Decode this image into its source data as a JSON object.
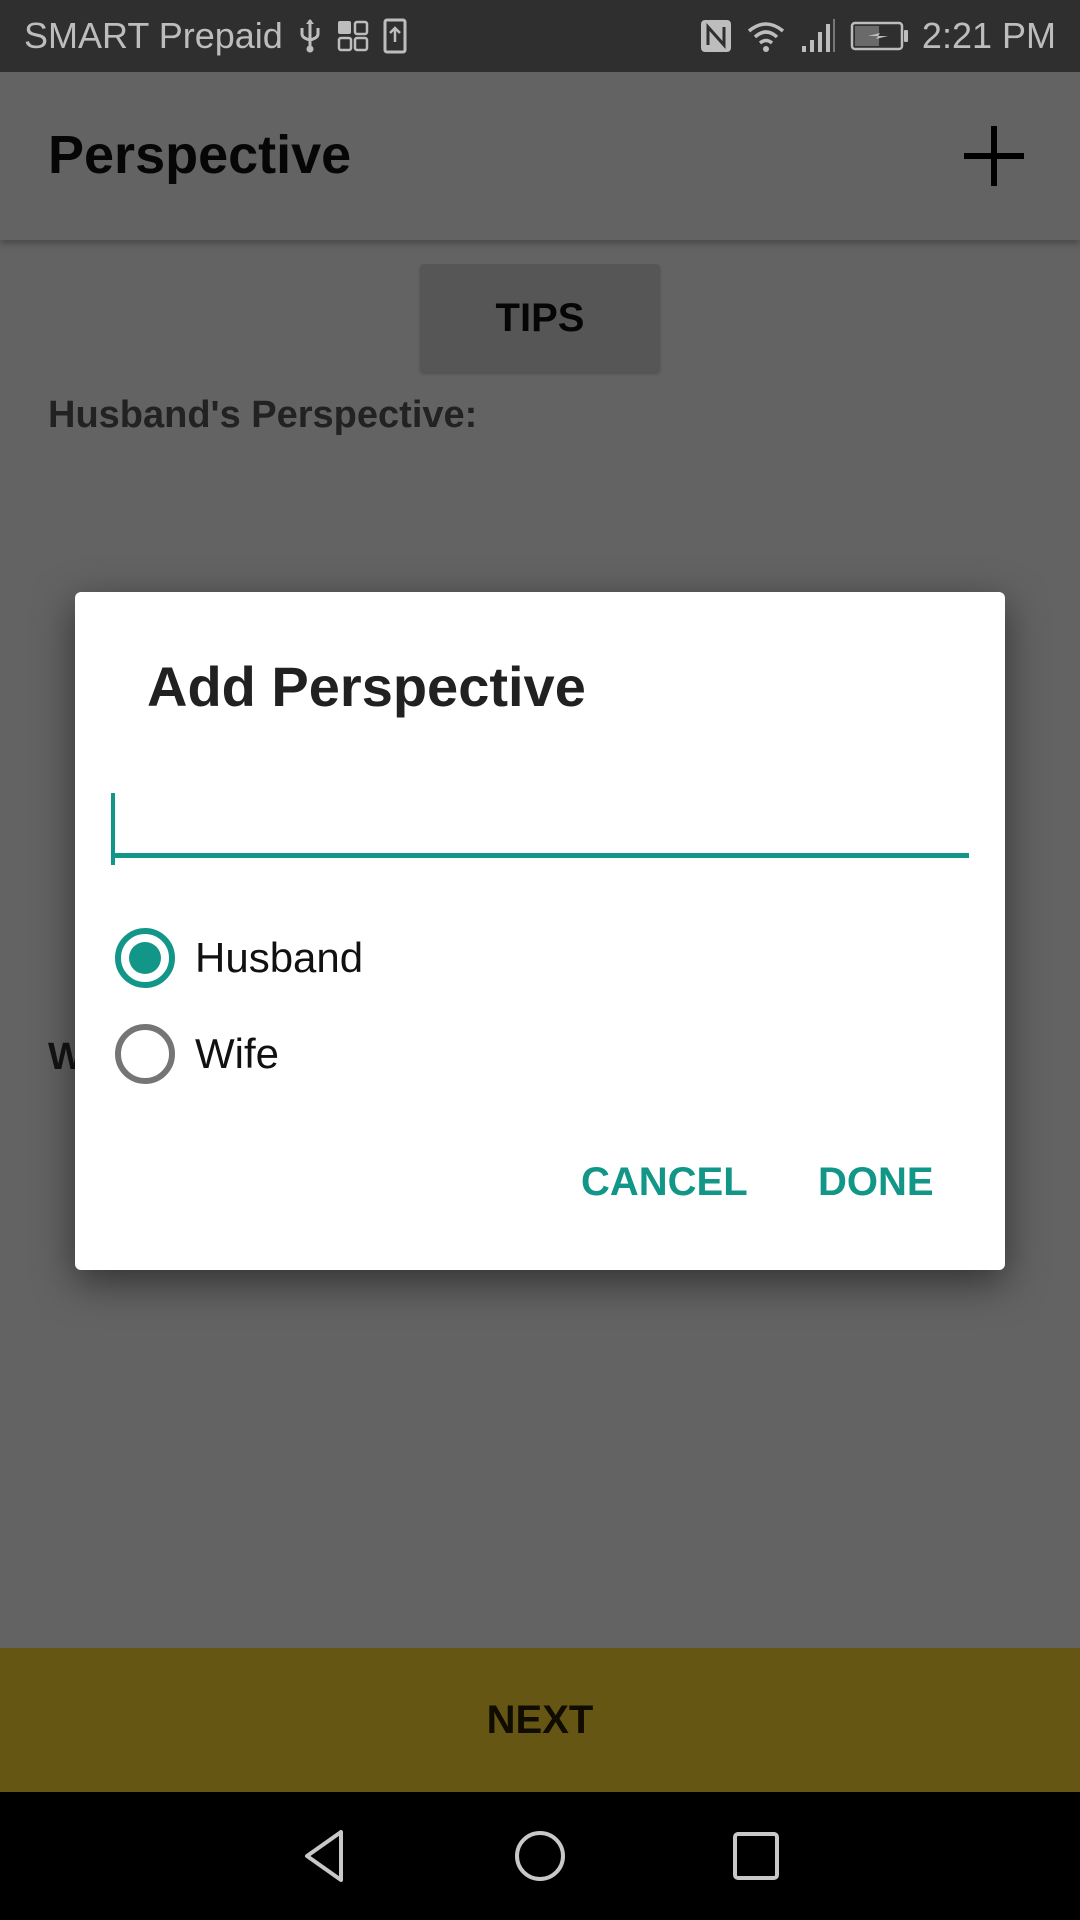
{
  "status_bar": {
    "carrier": "SMART Prepaid",
    "left_icons": [
      "usb-icon",
      "app-grid-icon",
      "upload-icon"
    ],
    "right_icons": [
      "nfc-icon",
      "wifi-icon",
      "signal-icon",
      "battery-charging-icon"
    ],
    "time": "2:21 PM"
  },
  "toolbar": {
    "title": "Perspective",
    "add_icon": "plus-icon"
  },
  "main": {
    "tips_label": "TIPS",
    "husband_section_label": "Husband's Perspective:",
    "wife_section_label_visible": "W",
    "next_label": "NEXT"
  },
  "dialog": {
    "title": "Add Perspective",
    "input_value": "",
    "options": [
      {
        "label": "Husband",
        "selected": true
      },
      {
        "label": "Wife",
        "selected": false
      }
    ],
    "cancel_label": "CANCEL",
    "done_label": "DONE",
    "accent_color": "#129688"
  },
  "nav_bar": {
    "buttons": [
      "back-icon",
      "home-icon",
      "recents-icon"
    ]
  }
}
